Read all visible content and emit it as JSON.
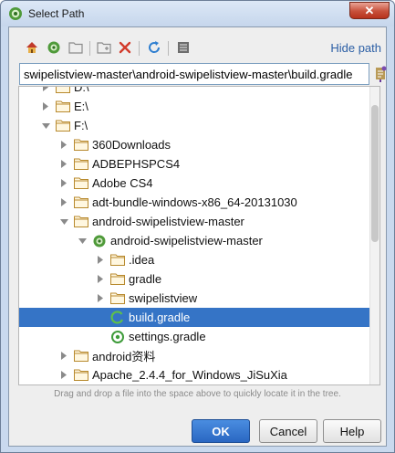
{
  "window": {
    "title": "Select Path",
    "close_label": "✕"
  },
  "toolbar": {
    "hide_path_label": "Hide path",
    "icons": [
      "home-icon",
      "project-icon",
      "folder-icon",
      "new-folder-icon",
      "delete-icon",
      "refresh-icon",
      "toggle-view-icon"
    ]
  },
  "path": {
    "value": "swipelistview-master\\android-swipelistview-master\\build.gradle"
  },
  "tree": {
    "rows": [
      {
        "label": "D:\\",
        "type": "folder",
        "depth": 1,
        "arrow": "right"
      },
      {
        "label": "E:\\",
        "type": "folder",
        "depth": 1,
        "arrow": "right"
      },
      {
        "label": "F:\\",
        "type": "folder",
        "depth": 1,
        "arrow": "down"
      },
      {
        "label": "360Downloads",
        "type": "folder",
        "depth": 2,
        "arrow": "right"
      },
      {
        "label": "ADBEPHSPCS4",
        "type": "folder",
        "depth": 2,
        "arrow": "right"
      },
      {
        "label": "Adobe CS4",
        "type": "folder",
        "depth": 2,
        "arrow": "right"
      },
      {
        "label": "adt-bundle-windows-x86_64-20131030",
        "type": "folder",
        "depth": 2,
        "arrow": "right"
      },
      {
        "label": "android-swipelistview-master",
        "type": "folder",
        "depth": 2,
        "arrow": "down"
      },
      {
        "label": "android-swipelistview-master",
        "type": "android",
        "depth": 3,
        "arrow": "down"
      },
      {
        "label": ".idea",
        "type": "folder",
        "depth": 4,
        "arrow": "right"
      },
      {
        "label": "gradle",
        "type": "folder",
        "depth": 4,
        "arrow": "right"
      },
      {
        "label": "swipelistview",
        "type": "folder",
        "depth": 4,
        "arrow": "right"
      },
      {
        "label": "build.gradle",
        "type": "gradle",
        "depth": 4,
        "arrow": "none",
        "selected": true
      },
      {
        "label": "settings.gradle",
        "type": "settings",
        "depth": 4,
        "arrow": "none"
      },
      {
        "label": "android资料",
        "type": "folder",
        "depth": 2,
        "arrow": "right"
      },
      {
        "label": "Apache_2.4.4_for_Windows_JiSuXia",
        "type": "folder",
        "depth": 2,
        "arrow": "right"
      }
    ]
  },
  "hint": "Drag and drop a file into the space above to quickly locate it in the tree.",
  "buttons": {
    "ok": "OK",
    "cancel": "Cancel",
    "help": "Help"
  },
  "colors": {
    "selection": "#3574c6",
    "link": "#2c5fa5",
    "folder": "#d8b56b"
  }
}
